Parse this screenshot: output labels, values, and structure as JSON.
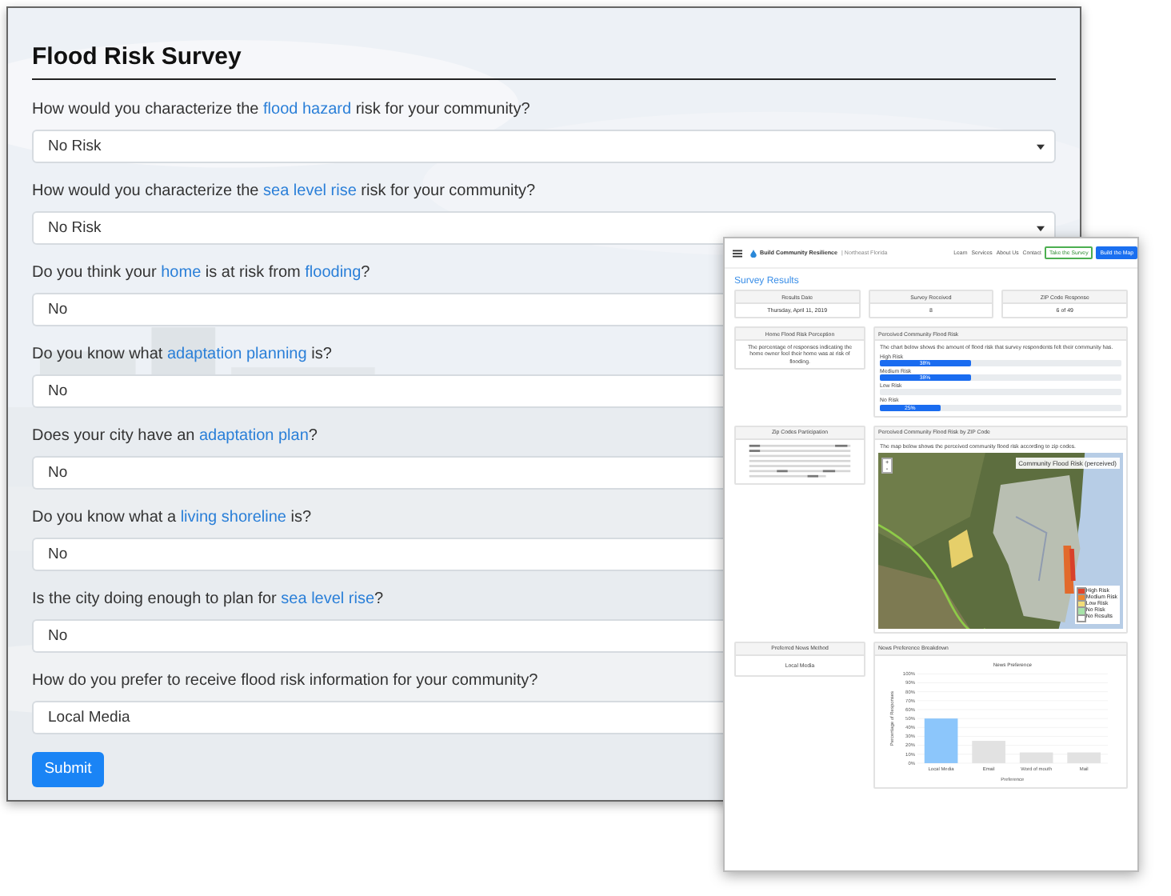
{
  "survey": {
    "title": "Flood Risk Survey",
    "submit": "Submit",
    "questions": [
      {
        "parts": [
          {
            "text": "How would you characterize the "
          },
          {
            "text": "flood hazard",
            "link": true
          },
          {
            "text": " risk for your community?"
          }
        ],
        "answer": "No Risk",
        "arrow_visible": true
      },
      {
        "parts": [
          {
            "text": "How would you characterize the "
          },
          {
            "text": "sea level rise",
            "link": true
          },
          {
            "text": " risk for your community?"
          }
        ],
        "answer": "No Risk",
        "arrow_visible": true
      },
      {
        "parts": [
          {
            "text": "Do you think your "
          },
          {
            "text": "home",
            "link": true
          },
          {
            "text": " is at risk from "
          },
          {
            "text": "flooding",
            "link": true
          },
          {
            "text": "?"
          }
        ],
        "answer": "No",
        "arrow_visible": false
      },
      {
        "parts": [
          {
            "text": "Do you know what "
          },
          {
            "text": "adaptation planning",
            "link": true
          },
          {
            "text": " is?"
          }
        ],
        "answer": "No",
        "arrow_visible": false
      },
      {
        "parts": [
          {
            "text": "Does your city have an "
          },
          {
            "text": "adaptation plan",
            "link": true
          },
          {
            "text": "?"
          }
        ],
        "answer": "No",
        "arrow_visible": false
      },
      {
        "parts": [
          {
            "text": "Do you know what a "
          },
          {
            "text": "living shoreline",
            "link": true
          },
          {
            "text": " is?"
          }
        ],
        "answer": "No",
        "arrow_visible": false
      },
      {
        "parts": [
          {
            "text": "Is the city doing enough to plan for "
          },
          {
            "text": "sea level rise",
            "link": true
          },
          {
            "text": "?"
          }
        ],
        "answer": "No",
        "arrow_visible": false
      },
      {
        "parts": [
          {
            "text": "How do you prefer to receive flood risk information for your community?"
          }
        ],
        "answer": "Local Media",
        "arrow_visible": false
      }
    ]
  },
  "results_page": {
    "brand": "Build Community Resilience",
    "region": "| Northeast Florida",
    "nav": [
      "Learn",
      "Services",
      "About Us",
      "Contact"
    ],
    "buttons": [
      {
        "label": "Take the Survey",
        "kind": "outline"
      },
      {
        "label": "Build the Map",
        "kind": "solid"
      }
    ],
    "heading": "Survey Results",
    "stats": [
      {
        "label": "Results Date",
        "value": "Thursday, April 11, 2019"
      },
      {
        "label": "Survey Received",
        "value": "8"
      },
      {
        "label": "ZIP Code Response",
        "value": "6 of 49"
      }
    ],
    "home_card": {
      "title": "Home Flood Risk Perception",
      "text": "The percentage of responses indicating the home owner feel their home was at risk of flooding."
    },
    "risk_card": {
      "title": "Perceived Community Flood Risk",
      "text": "The chart below shows the amount of flood risk that survey respondents felt their community has.",
      "bars": [
        {
          "label": "High Risk",
          "level": 0.375,
          "reading": "38%"
        },
        {
          "label": "Medium Risk",
          "level": 0.375,
          "reading": "38%"
        },
        {
          "label": "Low Risk",
          "level": 0
        },
        {
          "label": "No Risk",
          "level": 0.25,
          "reading": "25%"
        }
      ]
    },
    "zip_card": {
      "title": "Zip Codes Participation"
    },
    "map_card": {
      "title": "Perceived Community Flood Risk by ZIP Code",
      "text": "The map below shows the perceived community flood risk according to zip codes.",
      "zoom_in": "+",
      "zoom_out": "-",
      "legend": {
        "title": "Community Flood Risk (perceived)",
        "items": [
          {
            "label": "High Risk",
            "color": "#e0452c"
          },
          {
            "label": "Medium Risk",
            "color": "#f0862c"
          },
          {
            "label": "Low Risk",
            "color": "#f3de7a"
          },
          {
            "label": "No Risk",
            "color": "#a6e3a8"
          },
          {
            "label": "No Results",
            "color": "#ffffff"
          }
        ]
      }
    },
    "news_card": {
      "title": "Preferred News Method",
      "value": "Local Media"
    },
    "breakdown_card": {
      "title": "News Preference Breakdown",
      "chart_data": {
        "type": "bar",
        "title": "News Preference",
        "xlabel": "Preference",
        "ylabel": "Percentage of Responses",
        "categories": [
          "Local Media",
          "Email",
          "Word of mouth",
          "Mail"
        ],
        "grid": true,
        "series": [
          {
            "color": "#8cc6fb",
            "values": [
              50,
              null,
              null,
              null
            ]
          },
          {
            "color": "#e2e2e2",
            "values": [
              null,
              25,
              12,
              12
            ]
          }
        ],
        "ylim": [
          0,
          100
        ],
        "yticks": [
          {
            "value": 0,
            "label": "0%"
          },
          {
            "value": 10,
            "label": "10%"
          },
          {
            "value": 20,
            "label": "20%"
          },
          {
            "value": 30,
            "label": "30%"
          },
          {
            "value": 40,
            "label": "40%"
          },
          {
            "value": 50,
            "label": "50%"
          },
          {
            "value": 60,
            "label": "60%"
          },
          {
            "value": 70,
            "label": "70%"
          },
          {
            "value": 80,
            "label": "80%"
          },
          {
            "value": 90,
            "label": "90%"
          },
          {
            "value": 100,
            "label": "100%"
          }
        ]
      }
    }
  }
}
